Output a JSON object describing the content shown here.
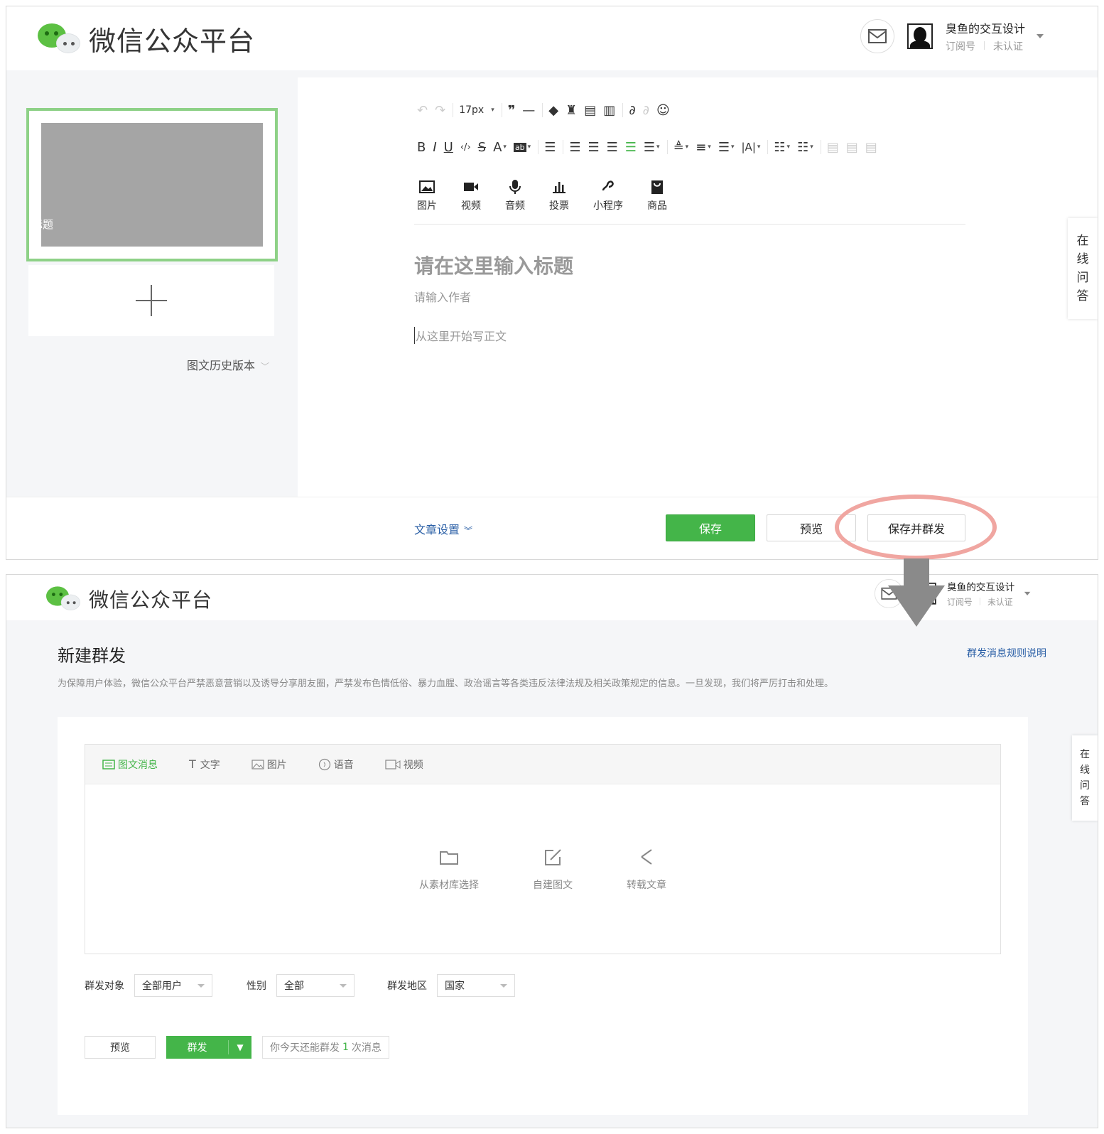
{
  "brand": {
    "name": "微信公众平台"
  },
  "account": {
    "name": "臭鱼的交互设计",
    "type": "订阅号",
    "status": "未认证"
  },
  "side_help": [
    "在",
    "线",
    "问",
    "答"
  ],
  "editor": {
    "font_size": "17px",
    "insert_items": [
      {
        "label": "图片",
        "icon": "image-icon"
      },
      {
        "label": "视频",
        "icon": "video-icon"
      },
      {
        "label": "音频",
        "icon": "mic-icon"
      },
      {
        "label": "投票",
        "icon": "vote-icon"
      },
      {
        "label": "小程序",
        "icon": "miniprogram-icon"
      },
      {
        "label": "商品",
        "icon": "bag-icon"
      }
    ],
    "title_placeholder": "请在这里输入标题",
    "author_placeholder": "请输入作者",
    "body_placeholder": "从这里开始写正文",
    "card_title": "标题",
    "history_label": "图文历史版本",
    "article_settings": "文章设置",
    "save": "保存",
    "preview": "预览",
    "save_and_send": "保存并群发"
  },
  "mass_send": {
    "title": "新建群发",
    "rules_link": "群发消息规则说明",
    "notice": "为保障用户体验，微信公众平台严禁恶意营销以及诱导分享朋友圈，严禁发布色情低俗、暴力血腥、政治谣言等各类违反法律法规及相关政策规定的信息。一旦发现，我们将严厉打击和处理。",
    "tabs": [
      "图文消息",
      "文字",
      "图片",
      "语音",
      "视频"
    ],
    "options": [
      "从素材库选择",
      "自建图文",
      "转载文章"
    ],
    "target_label": "群发对象",
    "target_value": "全部用户",
    "gender_label": "性别",
    "gender_value": "全部",
    "region_label": "群发地区",
    "region_value": "国家",
    "preview": "预览",
    "send": "群发",
    "remain_pre": "你今天还能群发",
    "remain_count": "1",
    "remain_post": "次消息"
  },
  "colors": {
    "accent": "#44b549",
    "link": "#2a5fa6",
    "highlight": "#f0a6a1"
  }
}
